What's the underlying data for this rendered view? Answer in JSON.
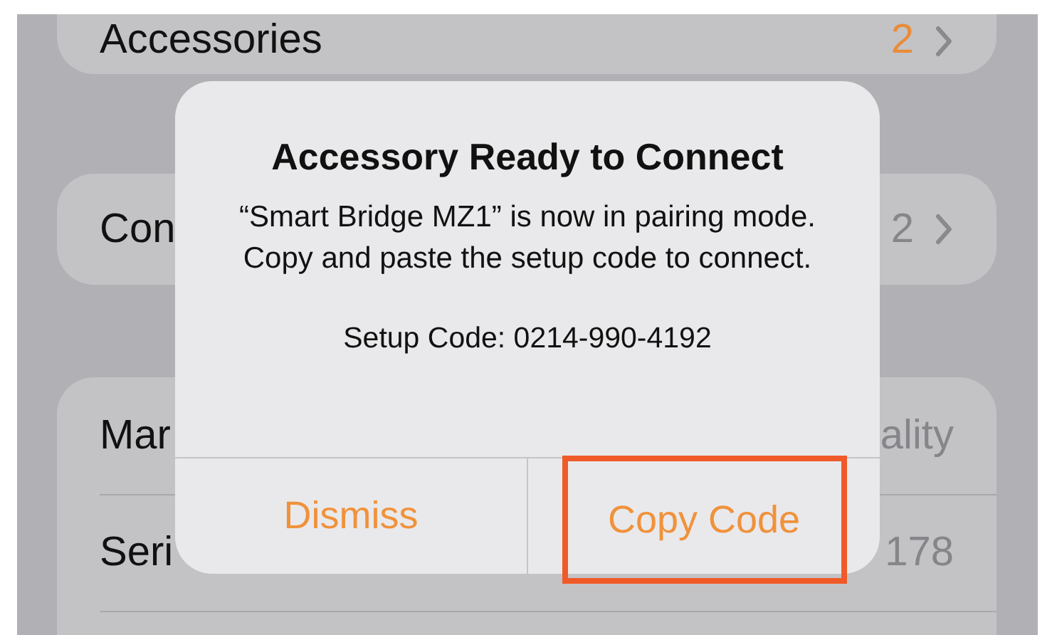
{
  "background_list": {
    "groups": [
      {
        "rows": [
          {
            "label": "Accessories",
            "value": "2",
            "accent": true,
            "chevron": true
          }
        ]
      },
      {
        "rows": [
          {
            "label": "Con",
            "value": "2",
            "accent": false,
            "chevron": true
          }
        ]
      },
      {
        "rows": [
          {
            "label": "Mar",
            "value": "ality",
            "accent": false,
            "chevron": false
          },
          {
            "label": "Seri",
            "value": "178",
            "accent": false,
            "chevron": false
          }
        ]
      }
    ]
  },
  "alert": {
    "title": "Accessory Ready to Connect",
    "message": "“Smart Bridge MZ1” is now in pairing mode. Copy and paste the setup code to connect.",
    "setup_code": "Setup Code: 0214-990-4192",
    "actions": [
      {
        "label": "Dismiss",
        "highlighted": false
      },
      {
        "label": "Copy Code",
        "highlighted": true
      }
    ]
  }
}
